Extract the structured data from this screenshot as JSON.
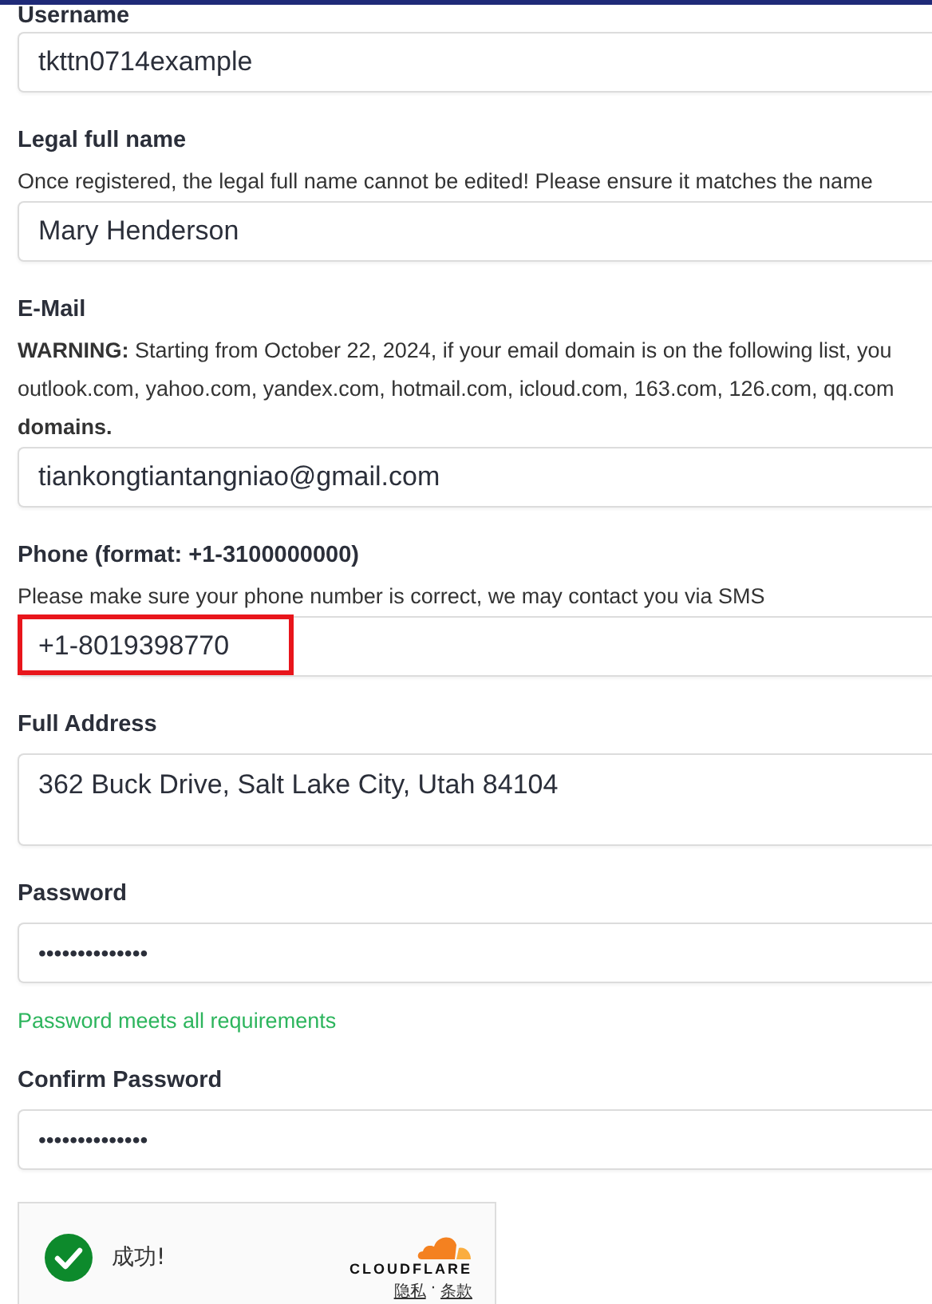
{
  "fields": [
    {
      "kind": "input",
      "label": "Username",
      "value": "tkttn0714example"
    },
    {
      "kind": "input",
      "label": "Legal full name",
      "help": [
        "Once registered, the legal full name cannot be edited! Please ensure it matches the name"
      ],
      "value": "Mary Henderson"
    },
    {
      "kind": "input",
      "label": "E-Mail",
      "help": [
        "**WARNING:** Starting from October 22, 2024, if your email domain is on the following list, you",
        "outlook.com, yahoo.com, yandex.com, hotmail.com, icloud.com, 163.com, 126.com, qq.com",
        "**domains.**"
      ],
      "value": "tiankongtiantangniao@gmail.com"
    },
    {
      "kind": "input",
      "label": "Phone (format: +1-3100000000)",
      "help": [
        "Please make sure your phone number is correct, we may contact you via SMS"
      ],
      "value": "+1-8019398770",
      "highlighted": true
    },
    {
      "kind": "textarea",
      "label": "Full Address",
      "value": "362 Buck Drive, Salt Lake City, Utah 84104"
    },
    {
      "kind": "password",
      "label": "Password",
      "value": "••••••••••••••",
      "status": "Password meets all requirements"
    },
    {
      "kind": "password",
      "label": "Confirm Password",
      "value": "••••••••••••••"
    }
  ],
  "captcha": {
    "status": "成功!",
    "brand": "CLOUDFLARE",
    "links": [
      "隐私",
      "条款"
    ],
    "separator": "·"
  }
}
